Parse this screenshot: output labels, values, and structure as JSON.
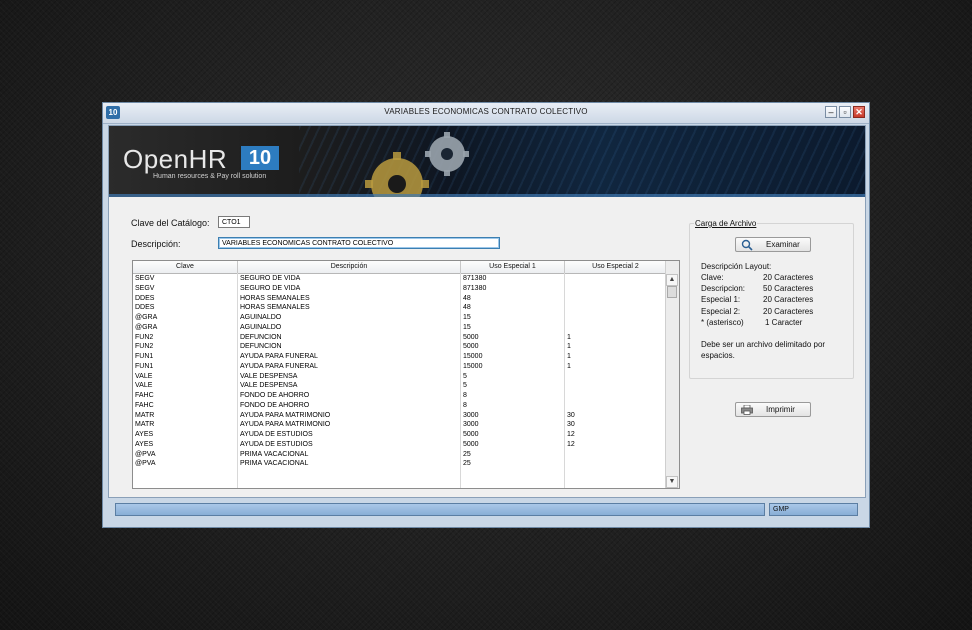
{
  "window": {
    "app_icon": "10",
    "title": "VARIABLES ECONOMICAS CONTRATO COLECTIVO",
    "controls": {
      "minimize": "‒",
      "maximize": "▫",
      "close": "✕"
    }
  },
  "banner": {
    "logo_text": "OpenHR",
    "logo_version": "10",
    "tagline": "Human resources & Pay roll solution"
  },
  "form": {
    "catalog_key_label": "Clave del Catálogo:",
    "catalog_key_value": "CTO1",
    "description_label": "Descripción:",
    "description_value": "VARIABLES ECONOMICAS CONTRATO COLECTIVO"
  },
  "grid": {
    "columns": [
      "Clave",
      "Descripción",
      "Uso Especial 1",
      "Uso Especial 2"
    ],
    "rows": [
      [
        "SEGV",
        "SEGURO DE VIDA",
        "871380",
        ""
      ],
      [
        "SEGV",
        "SEGURO DE VIDA",
        "871380",
        ""
      ],
      [
        "DDES",
        "HORAS SEMANALES",
        "48",
        ""
      ],
      [
        "DDES",
        "HORAS SEMANALES",
        "48",
        ""
      ],
      [
        "@GRA",
        "AGUINALDO",
        "15",
        ""
      ],
      [
        "@GRA",
        "AGUINALDO",
        "15",
        ""
      ],
      [
        "FUN2",
        "DEFUNCION",
        "5000",
        "1"
      ],
      [
        "FUN2",
        "DEFUNCION",
        "5000",
        "1"
      ],
      [
        "FUN1",
        "AYUDA PARA FUNERAL",
        "15000",
        "1"
      ],
      [
        "FUN1",
        "AYUDA PARA FUNERAL",
        "15000",
        "1"
      ],
      [
        "VALE",
        "VALE DESPENSA",
        "5",
        ""
      ],
      [
        "VALE",
        "VALE DESPENSA",
        "5",
        ""
      ],
      [
        "FAHC",
        "FONDO DE AHORRO",
        "8",
        ""
      ],
      [
        "FAHC",
        "FONDO DE AHORRO",
        "8",
        ""
      ],
      [
        "MATR",
        "AYUDA PARA MATRIMONIO",
        "3000",
        "30"
      ],
      [
        "MATR",
        "AYUDA PARA MATRIMONIO",
        "3000",
        "30"
      ],
      [
        "AYES",
        "AYUDA DE ESTUDIOS",
        "5000",
        "12"
      ],
      [
        "AYES",
        "AYUDA DE ESTUDIOS",
        "5000",
        "12"
      ],
      [
        "@PVA",
        "PRIMA VACACIONAL",
        "25",
        ""
      ],
      [
        "@PVA",
        "PRIMA VACACIONAL",
        "25",
        ""
      ]
    ]
  },
  "file_panel": {
    "title": "Carga de Archivo",
    "browse_button": "Examinar",
    "layout_heading": "Descripción Layout:",
    "layout_rows": [
      {
        "field": "Clave:",
        "size": "20 Caracteres"
      },
      {
        "field": "Descripcion:",
        "size": "50 Caracteres"
      },
      {
        "field": "Especial 1:",
        "size": "20 Caracteres"
      },
      {
        "field": "Especial 2:",
        "size": "20 Caracteres"
      },
      {
        "field": "* (asterisco)",
        "size": "1  Caracter"
      }
    ],
    "note_line1": "Debe ser un archivo delimitado por",
    "note_line2": "espacios."
  },
  "print_button": "Imprimir",
  "status": {
    "right": "GMP"
  },
  "icons": {
    "search": "search-icon",
    "printer": "printer-icon"
  }
}
